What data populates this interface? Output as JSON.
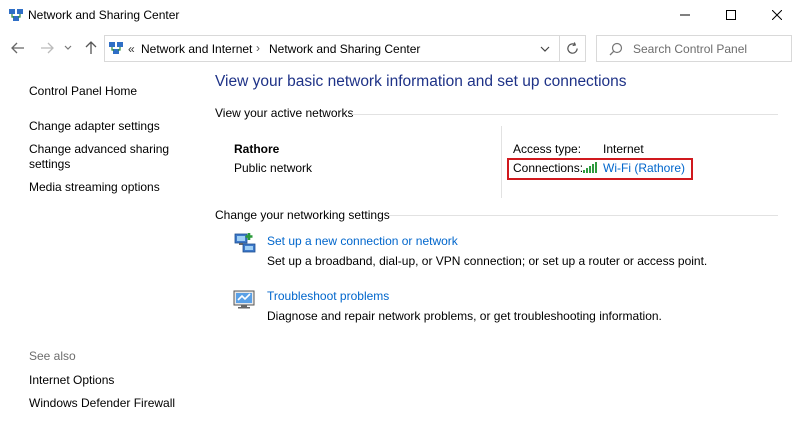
{
  "window": {
    "title": "Network and Sharing Center"
  },
  "address": {
    "overflow": "«",
    "crumbs": [
      "Network and Internet",
      "Network and Sharing Center"
    ]
  },
  "search": {
    "placeholder": "Search Control Panel"
  },
  "sidebar": {
    "home": "Control Panel Home",
    "items": [
      "Change adapter settings",
      "Change advanced sharing settings",
      "Media streaming options"
    ],
    "see_also_label": "See also",
    "see_also": [
      "Internet Options",
      "Windows Defender Firewall"
    ]
  },
  "main": {
    "title": "View your basic network information and set up connections",
    "active_header": "View your active networks",
    "network": {
      "name": "Rathore",
      "type": "Public network",
      "access_label": "Access type:",
      "access_value": "Internet",
      "connections_label": "Connections:",
      "connection_link": "Wi-Fi (Rathore)"
    },
    "change_header": "Change your networking settings",
    "tasks": [
      {
        "link": "Set up a new connection or network",
        "desc": "Set up a broadband, dial-up, or VPN connection; or set up a router or access point."
      },
      {
        "link": "Troubleshoot problems",
        "desc": "Diagnose and repair network problems, or get troubleshooting information."
      }
    ]
  },
  "colors": {
    "title_blue": "#1e3287",
    "link_blue": "#0066cc",
    "highlight_red": "#d0191e"
  },
  "icons": [
    "network-center-icon",
    "minimize-icon",
    "maximize-icon",
    "close-icon",
    "back-arrow-icon",
    "forward-arrow-icon",
    "chevron-down-icon",
    "up-arrow-icon",
    "refresh-icon",
    "search-icon",
    "wifi-signal-icon",
    "new-connection-icon",
    "troubleshoot-icon"
  ]
}
